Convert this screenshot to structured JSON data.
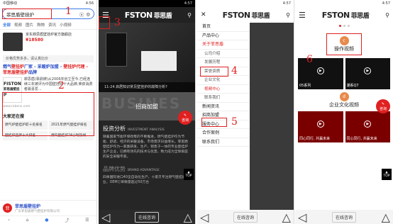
{
  "status": {
    "p1_left": "中国移动",
    "p1_time": "4:56",
    "p2_time": "4:57",
    "p3_time": "4:57",
    "p4_time": "4:57"
  },
  "panel1": {
    "query": "菲思盾壁挂炉",
    "tabs": [
      "全部",
      "视频",
      "图片",
      "购物",
      "资讯",
      "小视频"
    ],
    "ad_title": "京东菲思盾壁挂炉官方旗舰店",
    "ad_price": "¥18580",
    "search_hint": "价格优势多多，请认真比价",
    "result_title_a": "燃气",
    "result_title_b": "壁挂炉",
    "result_title_c": "厂家 - 采暖炉加盟 - ",
    "result_title_d": "壁挂炉代理 - 菲思盾壁挂炉",
    "result_title_e": "品牌",
    "logo_text": "FISTON",
    "logo_cn": "菲思盾壁挂炉",
    "result_desc": "菲思盾(靠鼎牌)从2006年创立至今,已经连续三年被评为中国壁挂炉十大品牌,荣获消费者最喜爱...",
    "result_url": "www.robens.com",
    "related_title": "大家还在搜",
    "related": [
      "燃气炉壁挂炉前十名排名",
      "2021年燃气壁挂炉排名",
      "壁挂炉品牌十大排名",
      "燃气壁挂炉24小时热线"
    ],
    "bottom_name": "菲思盾壁挂炉",
    "bottom_sub": "广东菲思盾燃气壁挂炉有限公司",
    "nav_icons": [
      "‹",
      "⌂",
      "●",
      "⤴",
      "☰"
    ]
  },
  "marks": {
    "m1": "1",
    "m2": "2",
    "m3": "3",
    "m4": "4",
    "m5": "5",
    "m6": "6"
  },
  "panel2": {
    "brand": "FSTON",
    "brand_cn": "菲思盾",
    "hero_caption": "11-24 启居知识常见壁挂炉的故障分析?",
    "band_bg": "BUSINES",
    "band_title": "招商加盟",
    "sec_title": "投资分析",
    "sec_en": "INVESTMENT ANALYSIS",
    "sec_body": "随着国家节能环保政策的不断推进，燃气壁挂炉作为节能、舒适、经济的采暖设备，市场需求日益增长。菲思盾壁挂炉作为一家集研发、生产、销售于一体的专业壁挂炉生产企业，已拥有领先的技术与优势，致力成为全球家庭的安全采暖专家。",
    "sec2_title": "品牌优势",
    "sec2_en": "BRAND ADVANTAGE",
    "sec2_body": "四季国际进口40全自动化生产，十家贝专注燃气壁挂炉行业，OEM订单数量超过50万台",
    "footer_label": "在线咨询",
    "zixun": "咨询",
    "top": "TOP"
  },
  "panel3": {
    "brand": "FSTON",
    "brand_cn": "菲思盾",
    "close": "✕",
    "items": [
      {
        "label": "首页",
        "sub": false
      },
      {
        "label": "产品中心",
        "sub": false
      },
      {
        "label": "关于菲思盾",
        "sub": false,
        "hl": true
      },
      {
        "label": "公司介绍",
        "sub": true
      },
      {
        "label": "发展历程",
        "sub": true
      },
      {
        "label": "荣誉资质",
        "sub": true
      },
      {
        "label": "企业文化",
        "sub": true
      },
      {
        "label": "视频中心",
        "sub": true,
        "hl": true
      },
      {
        "label": "联系我们",
        "sub": true
      },
      {
        "label": "新闻资讯",
        "sub": false
      },
      {
        "label": "招商加盟",
        "sub": false
      },
      {
        "label": "服务中心",
        "sub": false
      },
      {
        "label": "合作案例",
        "sub": false
      },
      {
        "label": "联系我们",
        "sub": false
      }
    ],
    "footer_label": "在线咨询"
  },
  "panel4": {
    "brand": "FSTON",
    "brand_cn": "菲思盾",
    "sec1_letter": "c",
    "sec1_title": "操作视频",
    "videos1": [
      {
        "cap": "05系列"
      },
      {
        "cap": "潮系Q7"
      },
      {
        "cap": ""
      },
      {
        "cap": ""
      }
    ],
    "sec2_letter": "d",
    "sec2_title": "企业文化视频",
    "videos2": [
      {
        "cap": "同心同行, 共赢未来"
      },
      {
        "cap": "同心同行, 共赢未来"
      }
    ],
    "footer_label": "在线咨询",
    "zixun": "咨询",
    "top": "TOP"
  },
  "colors": {
    "accent": "#e02020",
    "link": "#2a4fc8"
  }
}
